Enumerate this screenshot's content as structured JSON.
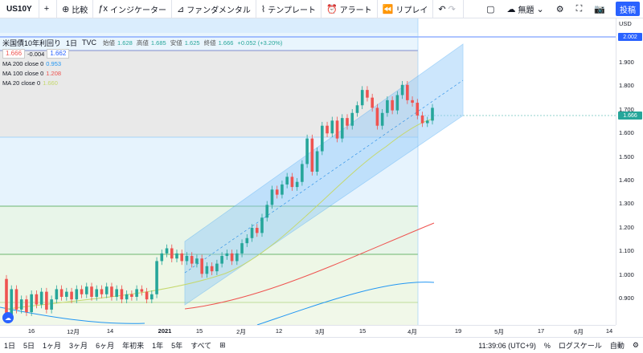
{
  "toolbar": {
    "symbol": "US10Y",
    "compare": "比較",
    "indicators": "インジケーター",
    "fundamentals": "ファンダメンタル",
    "templates": "テンプレート",
    "alerts": "アラート",
    "replay": "リプレイ",
    "layout_name": "無題",
    "post": "投稿"
  },
  "legend": {
    "title": "米国債10年利回り",
    "interval": "1日",
    "source": "TVC",
    "open_label": "始値",
    "open": "1.628",
    "high_label": "高値",
    "high": "1.685",
    "low_label": "安値",
    "low": "1.625",
    "close_label": "終値",
    "close": "1.666",
    "change": "+0.052 (+3.20%)",
    "bid": "1.666",
    "spread": "-0.004",
    "ask": "1.662",
    "ma200_label": "MA 200 close 0",
    "ma200_value": "0.953",
    "ma100_label": "MA 100 close 0",
    "ma100_value": "1.208",
    "ma20_label": "MA 20 close 0",
    "ma20_value": "1.660"
  },
  "price_axis": {
    "currency": "USD",
    "ticks": [
      "1.900",
      "1.800",
      "1.700",
      "1.600",
      "1.500",
      "1.400",
      "1.300",
      "1.200",
      "1.100",
      "1.000",
      "0.900"
    ],
    "badge_top": "2.002",
    "badge_last": "1.666"
  },
  "time_axis": {
    "ticks": [
      "16",
      "12月",
      "14",
      "2021",
      "15",
      "2月",
      "12",
      "3月",
      "15",
      "4月",
      "19",
      "5月",
      "17",
      "6月",
      "14"
    ]
  },
  "bottom_bar": {
    "ranges": [
      "1日",
      "5日",
      "1ヶ月",
      "3ヶ月",
      "6ヶ月",
      "年初来",
      "1年",
      "5年",
      "すべて"
    ],
    "time": "11:39:06 (UTC+9)",
    "percent": "%",
    "log": "ログスケール",
    "auto": "自動"
  },
  "colors": {
    "up": "#26a69a",
    "down": "#ef5350",
    "accent": "#2962ff",
    "ma200": "#2196f3",
    "ma100": "#ef5350",
    "ma20": "#c5d86d",
    "channel_fill": "#bbdefb"
  },
  "chart_data": {
    "type": "candlestick",
    "series_y_range": [
      0.82,
      2.02
    ],
    "candles": [
      [
        1.0,
        0.86
      ],
      [
        0.86,
        0.96
      ],
      [
        0.96,
        0.88
      ],
      [
        0.88,
        0.92
      ],
      [
        0.92,
        0.87
      ],
      [
        0.87,
        0.94
      ],
      [
        0.94,
        0.9
      ],
      [
        0.9,
        0.95
      ],
      [
        0.95,
        0.88
      ],
      [
        0.88,
        0.92
      ],
      [
        0.92,
        0.96
      ],
      [
        0.96,
        0.93
      ],
      [
        0.93,
        0.95
      ],
      [
        0.95,
        0.92
      ],
      [
        0.92,
        0.96
      ],
      [
        0.96,
        0.94
      ],
      [
        0.94,
        0.97
      ],
      [
        0.97,
        0.93
      ],
      [
        0.93,
        0.96
      ],
      [
        0.96,
        0.94
      ],
      [
        0.94,
        0.97
      ],
      [
        0.97,
        0.93
      ],
      [
        0.93,
        0.96
      ],
      [
        0.96,
        0.92
      ],
      [
        0.92,
        0.94
      ],
      [
        0.94,
        0.93
      ],
      [
        0.93,
        0.96
      ],
      [
        0.96,
        0.95
      ],
      [
        0.95,
        0.92
      ],
      [
        0.92,
        0.94
      ],
      [
        0.94,
        1.07
      ],
      [
        1.07,
        1.1
      ],
      [
        1.1,
        1.12
      ],
      [
        1.12,
        1.08
      ],
      [
        1.08,
        1.1
      ],
      [
        1.1,
        1.07
      ],
      [
        1.07,
        1.09
      ],
      [
        1.09,
        1.06
      ],
      [
        1.06,
        1.08
      ],
      [
        1.08,
        1.02
      ],
      [
        1.02,
        1.05
      ],
      [
        1.05,
        1.03
      ],
      [
        1.03,
        1.06
      ],
      [
        1.06,
        1.09
      ],
      [
        1.09,
        1.1
      ],
      [
        1.1,
        1.07
      ],
      [
        1.07,
        1.1
      ],
      [
        1.1,
        1.14
      ],
      [
        1.14,
        1.16
      ],
      [
        1.16,
        1.2
      ],
      [
        1.2,
        1.18
      ],
      [
        1.18,
        1.24
      ],
      [
        1.24,
        1.29
      ],
      [
        1.29,
        1.35
      ],
      [
        1.35,
        1.33
      ],
      [
        1.33,
        1.37
      ],
      [
        1.37,
        1.4
      ],
      [
        1.4,
        1.36
      ],
      [
        1.36,
        1.38
      ],
      [
        1.38,
        1.45
      ],
      [
        1.45,
        1.55
      ],
      [
        1.55,
        1.42
      ],
      [
        1.42,
        1.5
      ],
      [
        1.5,
        1.6
      ],
      [
        1.6,
        1.57
      ],
      [
        1.57,
        1.62
      ],
      [
        1.62,
        1.55
      ],
      [
        1.55,
        1.63
      ],
      [
        1.63,
        1.6
      ],
      [
        1.6,
        1.65
      ],
      [
        1.65,
        1.68
      ],
      [
        1.68,
        1.74
      ],
      [
        1.74,
        1.71
      ],
      [
        1.71,
        1.67
      ],
      [
        1.67,
        1.6
      ],
      [
        1.6,
        1.65
      ],
      [
        1.65,
        1.7
      ],
      [
        1.7,
        1.66
      ],
      [
        1.66,
        1.72
      ],
      [
        1.72,
        1.76
      ],
      [
        1.76,
        1.7
      ],
      [
        1.7,
        1.69
      ],
      [
        1.69,
        1.64
      ],
      [
        1.64,
        1.61
      ],
      [
        1.61,
        1.62
      ],
      [
        1.62,
        1.67
      ]
    ]
  }
}
